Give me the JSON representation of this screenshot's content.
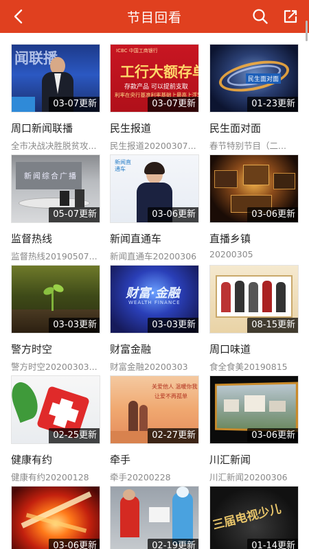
{
  "header": {
    "title": "节目回看",
    "back_icon": "back-arrow-icon",
    "search_icon": "search-icon",
    "share_icon": "share-icon",
    "color": "#e0401f"
  },
  "programs": [
    {
      "name": "周口新闻联播",
      "subtitle": "全市决战决胜脱贫攻...",
      "badge": "03-07更新",
      "thumb_text": "闻联播"
    },
    {
      "name": "民生报道",
      "subtitle": "民生报道20200307...",
      "badge": "03-07更新",
      "thumb_text": "工行大额存单",
      "thumb_text2": "存款产品 可以提前支取",
      "thumb_text3": "利率在央行基准利率基础上最高上浮50%"
    },
    {
      "name": "民生面对面",
      "subtitle": "春节特别节目（二...",
      "badge": "01-23更新",
      "thumb_text": "民生面对面"
    },
    {
      "name": "监督热线",
      "subtitle": "监督热线20190507...",
      "badge": "05-07更新",
      "thumb_text": "新闻综合广播"
    },
    {
      "name": "新闻直通车",
      "subtitle": "新闻直通车20200306",
      "badge": "03-06更新",
      "thumb_text": "新闻直通车"
    },
    {
      "name": "直播乡镇",
      "subtitle": "20200305",
      "badge": "03-06更新"
    },
    {
      "name": "警方时空",
      "subtitle": "警方时空20200303...",
      "badge": "03-03更新"
    },
    {
      "name": "财富金融",
      "subtitle": "财富金融20200303",
      "badge": "03-03更新",
      "thumb_text": "财富·金融",
      "thumb_text2": "WEALTH FINANCE"
    },
    {
      "name": "周口味道",
      "subtitle": "食全食美20190815",
      "badge": "08-15更新"
    },
    {
      "name": "健康有约",
      "subtitle": "健康有约20200128",
      "badge": "02-25更新"
    },
    {
      "name": "牵手",
      "subtitle": "牵手20200228",
      "badge": "02-27更新",
      "thumb_text": "关爱他人 温暖你我",
      "thumb_text2": "让爱不再孤单"
    },
    {
      "name": "川汇新闻",
      "subtitle": "川汇新闻20200306",
      "badge": "03-06更新"
    },
    {
      "name": "",
      "subtitle": "",
      "badge": "03-06更新"
    },
    {
      "name": "",
      "subtitle": "",
      "badge": "02-19更新"
    },
    {
      "name": "",
      "subtitle": "",
      "badge": "01-14更新",
      "thumb_text": "三届电视少儿"
    }
  ]
}
